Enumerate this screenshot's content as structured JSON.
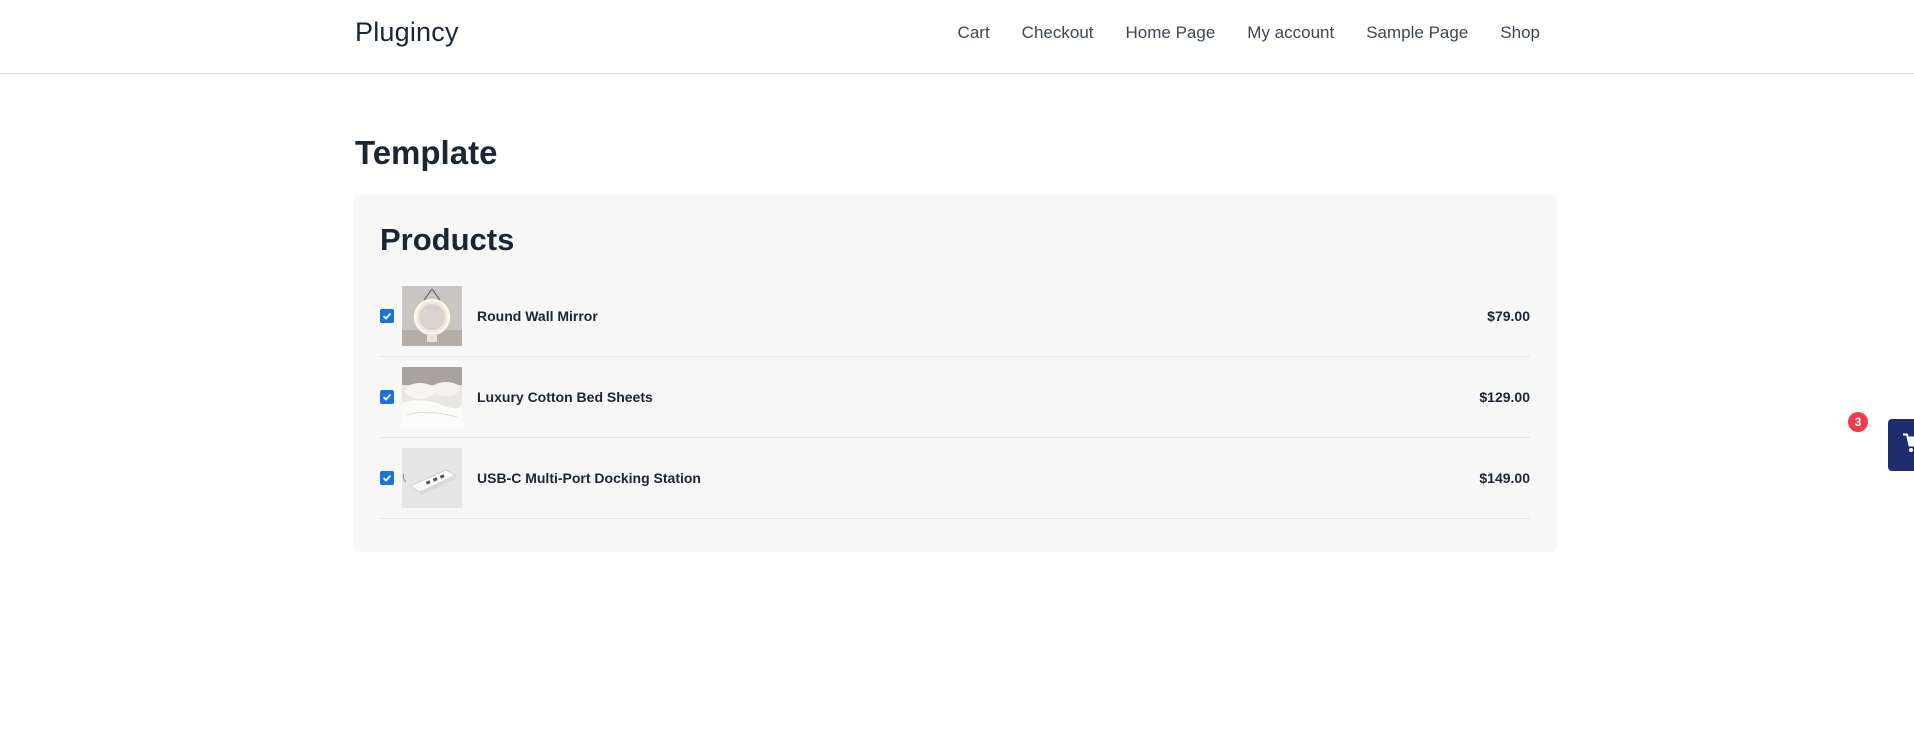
{
  "header": {
    "site_title": "Plugincy",
    "nav": [
      "Cart",
      "Checkout",
      "Home Page",
      "My account",
      "Sample Page",
      "Shop"
    ]
  },
  "page": {
    "title": "Template"
  },
  "products_panel": {
    "title": "Products",
    "items": [
      {
        "name": "Round Wall Mirror",
        "price": "$79.00",
        "checked": true
      },
      {
        "name": "Luxury Cotton Bed Sheets",
        "price": "$129.00",
        "checked": true
      },
      {
        "name": "USB-C Multi-Port Docking Station",
        "price": "$149.00",
        "checked": true
      }
    ]
  },
  "floating_cart": {
    "count": "3",
    "icon": "shopping-cart-icon"
  },
  "colors": {
    "accent": "#1a73d9",
    "cart_button": "#1e2d6e",
    "badge": "#ef3d4b"
  }
}
